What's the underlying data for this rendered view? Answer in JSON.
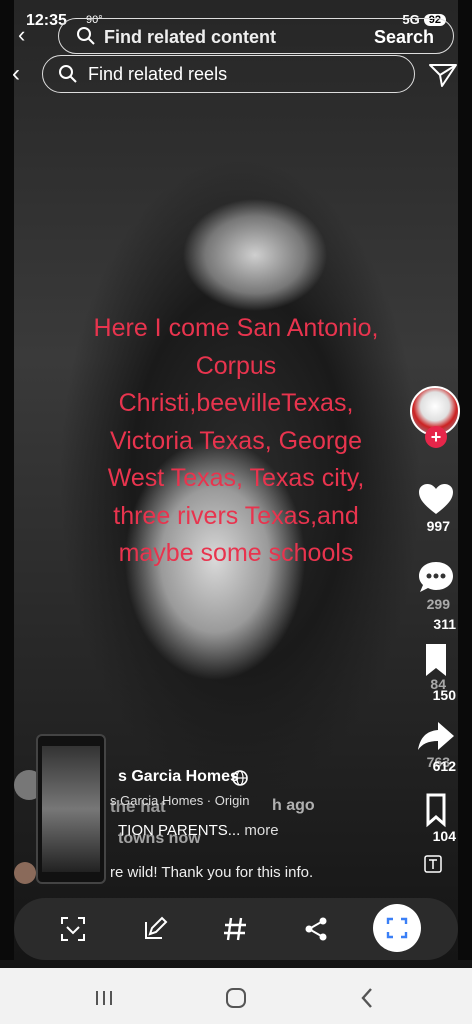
{
  "status": {
    "time": "12:35",
    "temp": "90°",
    "network": "5G",
    "battery": "92"
  },
  "top_search": {
    "placeholder": "Find related content",
    "button": "Search"
  },
  "reels_search": {
    "placeholder": "Find related reels"
  },
  "caption": {
    "lines": [
      "Here I come San Antonio,",
      "Corpus",
      "Christi,beevilleTexas,",
      "Victoria Texas, George",
      "West Texas, Texas city,",
      "three rivers Texas,and",
      "maybe some schools"
    ],
    "color": "#e8344e"
  },
  "rail": {
    "likes": "997",
    "comments_ghost": "299",
    "comments": "311",
    "saves_ghost": "84",
    "saves": "150",
    "shares_ghost": "763",
    "shares": "612",
    "reposts": "104"
  },
  "author": {
    "name": "s Garcia Homes",
    "subline": "s Garcia Homes · Origin",
    "ghost_title": "the hat",
    "ghost_ago": "h ago"
  },
  "description": {
    "text": "TION PARENTS",
    "more": "more",
    "ghost": "towns now"
  },
  "comment": {
    "text": "re wild! Thank you for this info."
  },
  "accent_color": "#e6264a"
}
